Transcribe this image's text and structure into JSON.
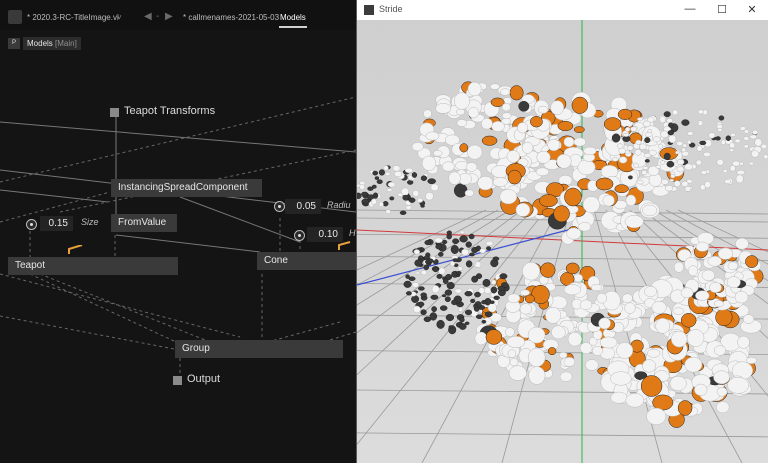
{
  "left_panel": {
    "tabs": [
      {
        "label": "* 2020.3-RC-TitleImage.vl",
        "active": false
      },
      {
        "label": "* callmenames-2021-05-03",
        "active": false
      },
      {
        "label": "Models",
        "active": true
      }
    ],
    "tab_menu_glyph": "˅",
    "nav_back": "◀",
    "nav_sep": "-",
    "nav_forward": "▶",
    "p_button": "P",
    "breadcrumb": {
      "name": "Models",
      "qualifier": "[Main]"
    },
    "nodes": {
      "teapot_transforms": "Teapot Transforms",
      "instancing": "InstancingSpreadComponent",
      "fromvalue": "FromValue",
      "teapot": "Teapot",
      "cone": "Cone",
      "group": "Group",
      "output": "Output"
    },
    "values": {
      "size_value": "0.15",
      "size_label": "Size",
      "radius_value": "0.05",
      "radius_label": "Radiu",
      "height_value": "0.10",
      "height_label": "H"
    },
    "accent": "#e8a13a"
  },
  "right_panel": {
    "title": "Stride",
    "minimize": "—",
    "maximize": "☐",
    "close": "✕",
    "colors": {
      "background": "#d6d6d6",
      "white_object": "#f3f3f3",
      "orange_object": "#e07a17",
      "dark_object": "#3a3a3a",
      "axis_x": "#d13a3a",
      "axis_y": "#2bb54a",
      "axis_z": "#3a4fd1"
    }
  }
}
